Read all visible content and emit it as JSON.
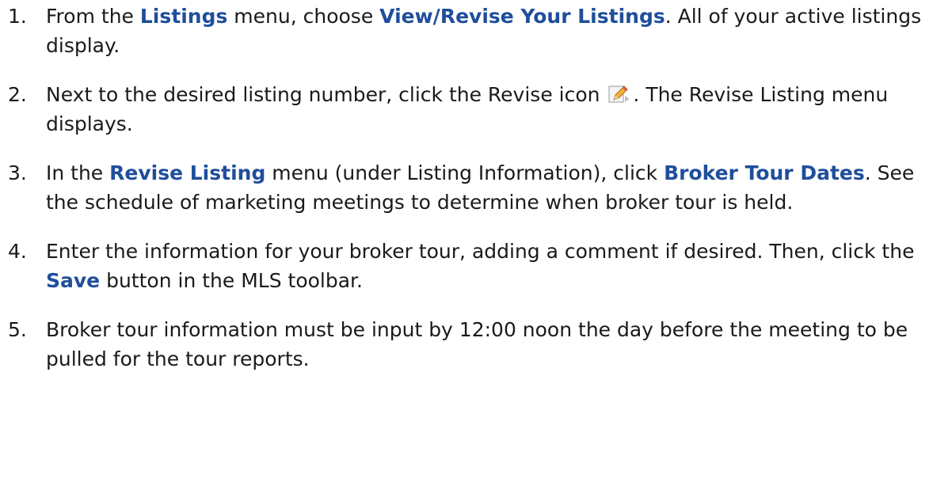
{
  "steps": [
    {
      "number": "1.",
      "parts": [
        {
          "text": "From the "
        },
        {
          "text": "Listings",
          "kw": true
        },
        {
          "text": " menu, choose "
        },
        {
          "text": "View/Revise Your Listings",
          "kw": true
        },
        {
          "text": ". All of your active listings display."
        }
      ]
    },
    {
      "number": "2.",
      "parts": [
        {
          "text": "Next to the desired listing number, click the Revise icon "
        },
        {
          "icon": "pencil-edit-icon"
        },
        {
          "text": ". The Revise Listing menu displays."
        }
      ]
    },
    {
      "number": "3.",
      "parts": [
        {
          "text": "In the "
        },
        {
          "text": "Revise Listing",
          "kw": true
        },
        {
          "text": " menu (under Listing Information), click "
        },
        {
          "text": "Broker Tour Dates",
          "kw": true
        },
        {
          "text": ".  See the schedule of marketing meetings to determine when broker tour is held."
        }
      ]
    },
    {
      "number": "4.",
      "parts": [
        {
          "text": "Enter the information for your broker tour, adding a comment if desired. Then, click the "
        },
        {
          "text": "Save",
          "kw": true
        },
        {
          "text": " button in the MLS toolbar."
        }
      ]
    },
    {
      "number": "5.",
      "parts": [
        {
          "text": "Broker tour information must be input by 12:00 noon the day before the meeting to be pulled for the tour reports."
        }
      ]
    }
  ],
  "colors": {
    "keyword": "#1f4e9b",
    "text": "#1a1a1a"
  }
}
